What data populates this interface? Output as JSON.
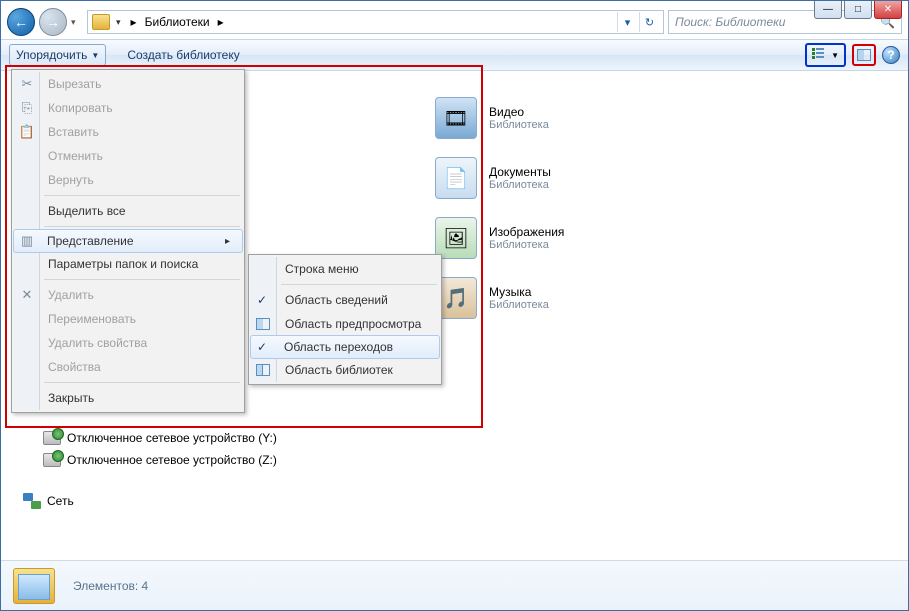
{
  "titlebar": {
    "minimize": "—",
    "maximize": "□",
    "close": "✕"
  },
  "nav": {
    "back_glyph": "←",
    "fwd_glyph": "→"
  },
  "breadcrumb": {
    "root": "Библиотеки",
    "sep": "▸"
  },
  "search": {
    "placeholder": "Поиск: Библиотеки"
  },
  "toolbar": {
    "organize": "Упорядочить",
    "new_library": "Создать библиотеку",
    "dropdown_glyph": "▼",
    "help_glyph": "?"
  },
  "organize_menu": {
    "cut": "Вырезать",
    "copy": "Копировать",
    "paste": "Вставить",
    "undo": "Отменить",
    "redo": "Вернуть",
    "select_all": "Выделить все",
    "layout": "Представление",
    "folder_options": "Параметры папок и поиска",
    "delete": "Удалить",
    "rename": "Переименовать",
    "remove_props": "Удалить свойства",
    "properties": "Свойства",
    "close": "Закрыть",
    "arrow": "▸"
  },
  "layout_submenu": {
    "menu_bar": "Строка меню",
    "details_pane": "Область сведений",
    "preview_pane": "Область предпросмотра",
    "navigation_pane": "Область переходов",
    "library_pane": "Область библиотек",
    "check": "✓"
  },
  "libraries": [
    {
      "name": "Видео",
      "sub": "Библиотека"
    },
    {
      "name": "Документы",
      "sub": "Библиотека"
    },
    {
      "name": "Изображения",
      "sub": "Библиотека"
    },
    {
      "name": "Музыка",
      "sub": "Библиотека"
    }
  ],
  "tree": {
    "drive_y": "Отключенное сетевое устройство (Y:)",
    "drive_z": "Отключенное сетевое устройство (Z:)",
    "network": "Сеть"
  },
  "status": {
    "label": "Элементов:",
    "count": "4"
  }
}
